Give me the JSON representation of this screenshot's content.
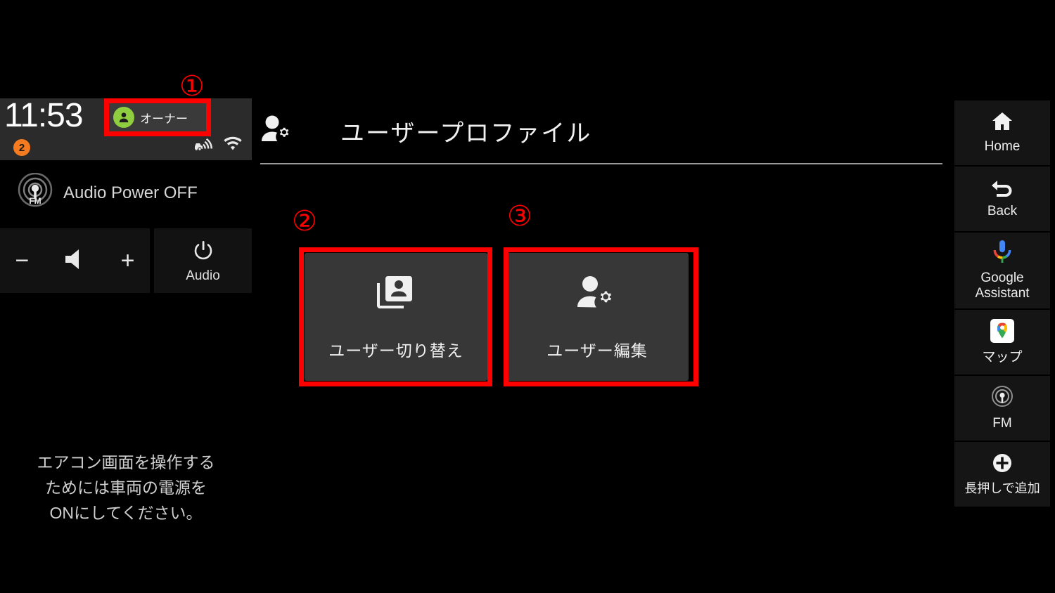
{
  "status_bar": {
    "time": "11:53",
    "notification_count": "2",
    "user_name": "オーナー",
    "icons": [
      "vehicle-connection-icon",
      "wifi-icon"
    ]
  },
  "audio_panel": {
    "source_icon": "fm-radio-icon",
    "status_text": "Audio Power OFF",
    "volume_down": "−",
    "volume_up": "+",
    "volume_icon": "speaker-icon",
    "audio_power_label": "Audio",
    "audio_power_icon": "power-icon"
  },
  "aircon_message": {
    "line1": "エアコン画面を操作する",
    "line2": "ためには車両の電源を",
    "line3": "ONにしてください。"
  },
  "main": {
    "title": "ユーザープロファイル",
    "title_icon": "user-settings-icon",
    "tiles": [
      {
        "label": "ユーザー切り替え",
        "icon": "switch-user-card-icon"
      },
      {
        "label": "ユーザー編集",
        "icon": "edit-user-icon"
      }
    ]
  },
  "sidebar": {
    "items": [
      {
        "label": "Home",
        "icon": "home-icon"
      },
      {
        "label": "Back",
        "icon": "back-arrow-icon"
      },
      {
        "label": "Google Assistant",
        "icon": "google-assistant-mic-icon"
      },
      {
        "label": "マップ",
        "icon": "google-maps-icon"
      },
      {
        "label": "FM",
        "icon": "fm-radio-icon"
      },
      {
        "label": "長押しで追加",
        "icon": "plus-circle-icon"
      }
    ]
  },
  "annotations": [
    {
      "number": "①"
    },
    {
      "number": "②"
    },
    {
      "number": "③"
    }
  ],
  "colors": {
    "accent_red": "#ff0000",
    "avatar_green": "#8fce3f",
    "badge_orange": "#f47b20",
    "tile_gray": "#373737",
    "status_bar_gray": "#2b2b2b"
  }
}
